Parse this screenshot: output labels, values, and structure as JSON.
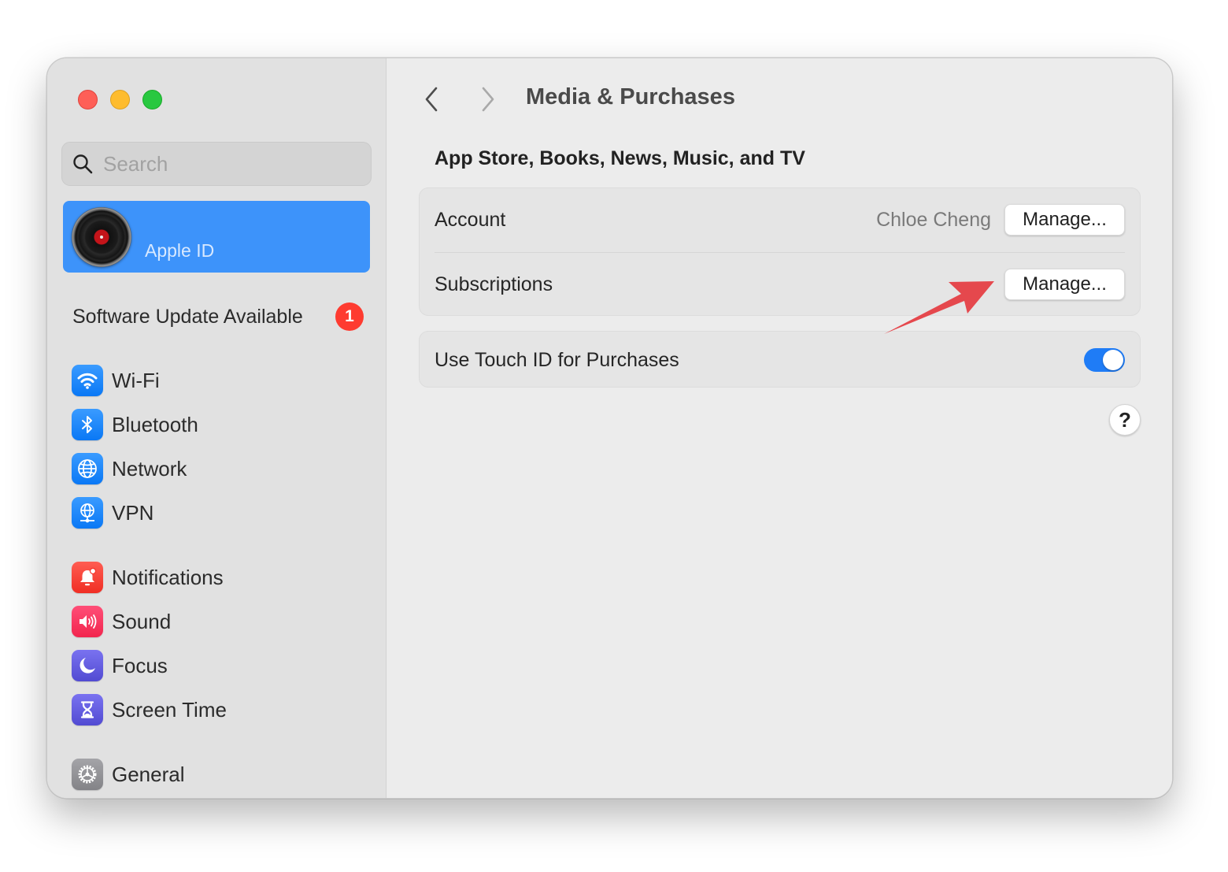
{
  "window": {
    "traffic_lights": [
      "close",
      "minimize",
      "zoom"
    ]
  },
  "sidebar": {
    "search": {
      "placeholder": "Search",
      "value": "",
      "icon": "magnifying-glass-icon"
    },
    "apple_id": {
      "label": "Apple ID",
      "avatar": "vinyl-record-avatar"
    },
    "software_update": {
      "label": "Software Update Available",
      "badge": "1"
    },
    "groups": [
      [
        {
          "label": "Wi-Fi",
          "icon": "wifi-icon",
          "color": "#0a7cf5"
        },
        {
          "label": "Bluetooth",
          "icon": "bluetooth-icon",
          "color": "#0a7cf5"
        },
        {
          "label": "Network",
          "icon": "globe-icon",
          "color": "#0a7cf5"
        },
        {
          "label": "VPN",
          "icon": "vpn-globe-icon",
          "color": "#0a7cf5"
        }
      ],
      [
        {
          "label": "Notifications",
          "icon": "bell-icon",
          "color": "#f5352b"
        },
        {
          "label": "Sound",
          "icon": "speaker-icon",
          "color": "#f42a53"
        },
        {
          "label": "Focus",
          "icon": "moon-icon",
          "color": "#5e56dc"
        },
        {
          "label": "Screen Time",
          "icon": "hourglass-icon",
          "color": "#5e56dc"
        }
      ],
      [
        {
          "label": "General",
          "icon": "gear-icon",
          "color": "#8e8e93"
        }
      ]
    ]
  },
  "main": {
    "title": "Media & Purchases",
    "section_title": "App Store, Books, News, Music, and TV",
    "rows": {
      "account": {
        "label": "Account",
        "value": "Chloe Cheng",
        "button": "Manage..."
      },
      "subscriptions": {
        "label": "Subscriptions",
        "button": "Manage..."
      },
      "touch_id": {
        "label": "Use Touch ID for Purchases",
        "enabled": true
      }
    },
    "help_label": "?"
  },
  "annotation": {
    "color": "#e5484d",
    "points_to": "subscriptions-manage-button"
  },
  "colors": {
    "accent": "#1f7cf6",
    "selection": "#3d93fa",
    "badge": "#fe3b30"
  }
}
